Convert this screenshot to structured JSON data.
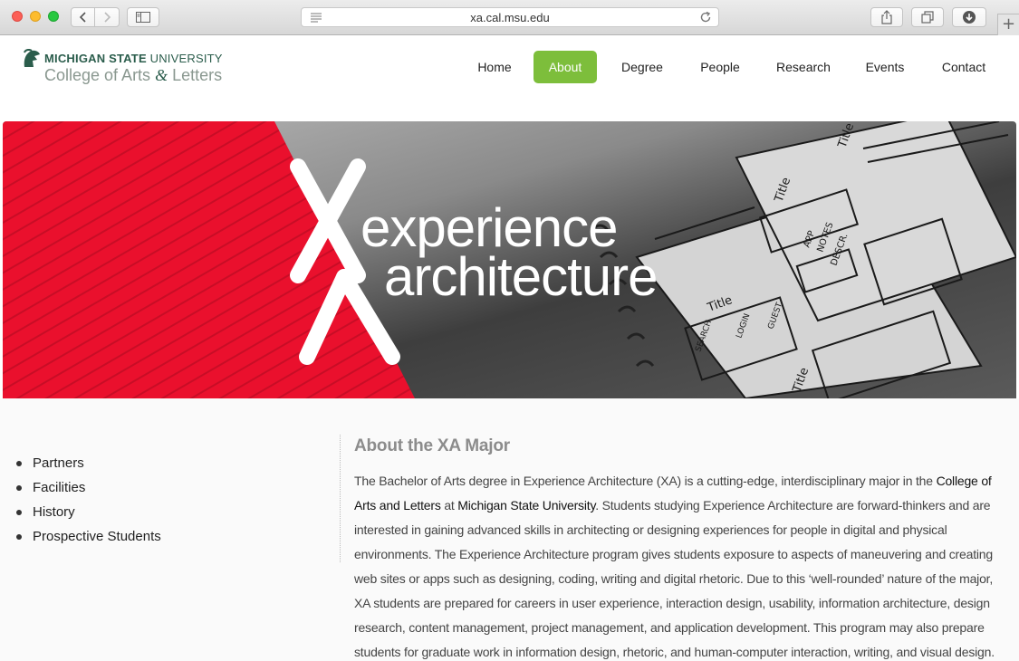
{
  "browser": {
    "url": "xa.cal.msu.edu"
  },
  "site": {
    "logo_bold": "MICHIGAN STATE",
    "logo_rest": " UNIVERSITY",
    "logo_college_a": "College of Arts ",
    "logo_amp": "&",
    "logo_college_b": " Letters",
    "nav": [
      {
        "label": "Home",
        "active": false
      },
      {
        "label": "About",
        "active": true
      },
      {
        "label": "Degree",
        "active": false
      },
      {
        "label": "People",
        "active": false
      },
      {
        "label": "Research",
        "active": false
      },
      {
        "label": "Events",
        "active": false
      },
      {
        "label": "Contact",
        "active": false
      }
    ],
    "accent_color": "#7dbe3b"
  },
  "hero": {
    "monogram_x": "X",
    "monogram_a": "A",
    "title_line1": "experience",
    "title_line2": "architecture",
    "stripe_color": "#e8102c",
    "sketch_labels": [
      "Title",
      "Title",
      "Title",
      "APP",
      "NOTES",
      "DESCR.",
      "SEARCH",
      "LOGIN",
      "GUEST",
      "Title"
    ]
  },
  "sidebar": {
    "items": [
      "Partners",
      "Facilities",
      "History",
      "Prospective Students"
    ]
  },
  "article": {
    "heading": "About the XA Major",
    "p_part1": "The Bachelor of Arts degree in Experience Architecture (XA) is a cutting-edge, interdisciplinary major in the ",
    "p_link1": "College of Arts and Letters",
    "p_part2": " at ",
    "p_link2": "Michigan State University",
    "p_part3": ".  Students studying Experience Architecture are forward-thinkers and are interested in gaining advanced skills in architecting or designing experiences for people in digital and physical environments.  The Experience Architecture program gives students exposure to aspects of maneuvering and creating web sites or apps such as designing, coding, writing and digital rhetoric. Due to this ‘well-rounded’ nature of the major, XA students are prepared for careers in user experience, interaction design, usability, information architecture, design research, content management, project management, and application development. This program may also prepare students for graduate work in information design, rhetoric, and human-computer interaction, writing, and visual design."
  }
}
